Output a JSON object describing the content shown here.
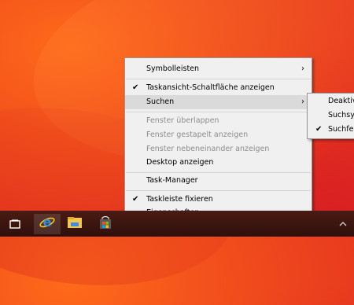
{
  "context_menu": {
    "items": [
      {
        "label": "Symbolleisten",
        "submenu": true
      },
      {
        "label": "Taskansicht-Schaltfläche anzeigen",
        "checked": true
      },
      {
        "label": "Suchen",
        "submenu": true,
        "highlighted": true
      },
      {
        "label": "Fenster überlappen",
        "disabled": true
      },
      {
        "label": "Fenster gestapelt anzeigen",
        "disabled": true
      },
      {
        "label": "Fenster nebeneinander anzeigen",
        "disabled": true
      },
      {
        "label": "Desktop anzeigen"
      },
      {
        "label": "Task-Manager"
      },
      {
        "label": "Taskleiste fixieren",
        "checked": true
      },
      {
        "label": "Eigenschaften"
      }
    ],
    "arrow_glyph": "›",
    "check_glyph": "✔"
  },
  "submenu": {
    "items": [
      {
        "label": "Deaktivi"
      },
      {
        "label": "Suchsym"
      },
      {
        "label": "Suchfeld",
        "checked": true
      }
    ]
  },
  "taskbar": {
    "buttons": [
      {
        "icon": "task-view-icon"
      },
      {
        "icon": "internet-explorer-icon"
      },
      {
        "icon": "file-explorer-icon"
      },
      {
        "icon": "store-icon"
      }
    ]
  },
  "colors": {
    "taskbar": "#3a1510",
    "menu_bg": "#f0f0f0",
    "highlight": "#dadada",
    "disabled_text": "#8d8d8d"
  }
}
